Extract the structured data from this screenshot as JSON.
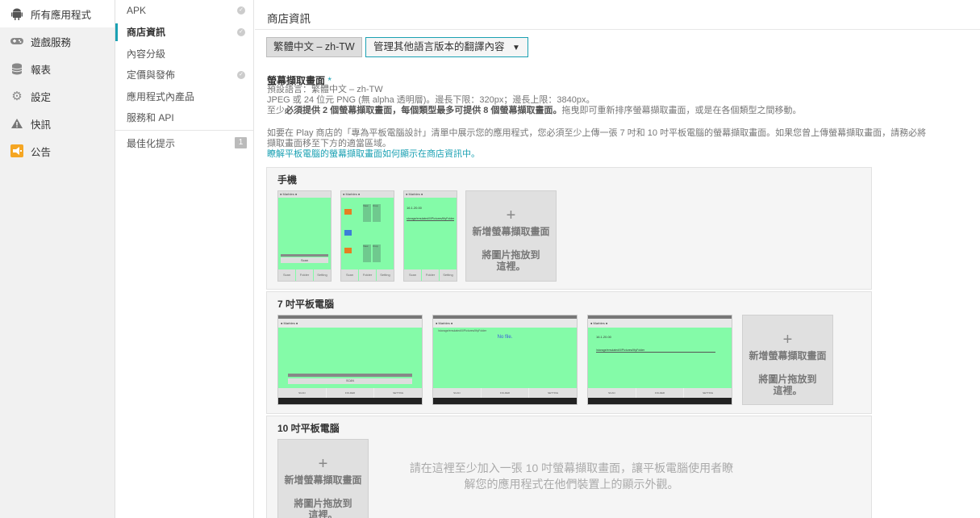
{
  "nav": {
    "items": [
      {
        "label": "所有應用程式",
        "icon": "android-icon"
      },
      {
        "label": "遊戲服務",
        "icon": "gamepad-icon"
      },
      {
        "label": "報表",
        "icon": "database-icon"
      },
      {
        "label": "設定",
        "icon": "gear-icon"
      },
      {
        "label": "快訊",
        "icon": "warning-icon"
      },
      {
        "label": "公告",
        "icon": "megaphone-icon"
      }
    ]
  },
  "subnav": {
    "items": [
      {
        "label": "APK"
      },
      {
        "label": "商店資訊"
      },
      {
        "label": "內容分級"
      },
      {
        "label": "定價與發佈"
      },
      {
        "label": "應用程式內產品"
      },
      {
        "label": "服務和 API"
      }
    ],
    "optimize_label": "最佳化提示",
    "optimize_count": "1"
  },
  "main": {
    "title": "商店資訊",
    "lang_button": "繁體中文 – zh-TW",
    "translations_button": "管理其他語言版本的翻譯內容",
    "translations_arrow": "▼",
    "section_label": "螢幕擷取畫面",
    "required_mark": "*",
    "default_lang": "預設語言：繁體中文 – zh-TW",
    "format_info": "JPEG 或 24 位元 PNG (無 alpha 透明層)。邊長下限：320px；邊長上限：3840px。",
    "min_prefix": "至少",
    "min_bold": "必須提供 2 個螢幕擷取畫面，每個類型最多可提供 8 個螢幕擷取畫面。",
    "min_suffix": "拖曳即可重新排序螢幕擷取畫面，或是在各個類型之間移動。",
    "tablet_info_1": "如要在 Play 商店的「專為平板電腦設計」清單中展示您的應用程式，您必須至少上傳一張 7 吋和 10 吋平板電腦的螢幕擷取畫面。如果您曾上傳螢幕擷取畫面，請務必將",
    "tablet_info_2": "擷取畫面移至下方的適當區域。",
    "learn_link": "瞭解平板電腦的螢幕擷取畫面如何顯示在商店資訊中。"
  },
  "phone": {
    "title": "手機",
    "app_name": "● Marbles ●",
    "actions": "SHARE   DELETE",
    "scan": "Scan",
    "bottom": [
      "Scan",
      "Folder",
      "Setting"
    ],
    "row_labels": [
      "View",
      "Crop"
    ],
    "size_label": "1 mb",
    "date": "16.1.20.00",
    "path_label": "storage/emulated/0/Pictures/MyFolder",
    "add_title": "新增螢幕擷取畫面",
    "add_sub": "將圖片拖放到這裡。"
  },
  "tablet7": {
    "title": "7 吋平板電腦",
    "app_name": "● Marbles ●",
    "actions": "SHARE   DELETE",
    "scan": "SCAN",
    "bottom": [
      "SCAN",
      "FOLDER",
      "SETTING"
    ],
    "path": "/storage/emulated/0/Pictures/MyFolder",
    "no_file": "No file.",
    "date": "16.1.20.00",
    "add_title": "新增螢幕擷取畫面",
    "add_sub": "將圖片拖放到這裡。"
  },
  "tablet10": {
    "title": "10 吋平板電腦",
    "add_title": "新增螢幕擷取畫面",
    "add_sub": "將圖片拖放到這裡。",
    "hint": "請在這裡至少加入一張 10 吋螢幕擷取畫面，讓平板電腦使用者瞭解您的應用程式在他們裝置上的顯示外觀。"
  },
  "colors": {
    "accent": "#1ba1b3",
    "screen_green": "#84fba8"
  }
}
